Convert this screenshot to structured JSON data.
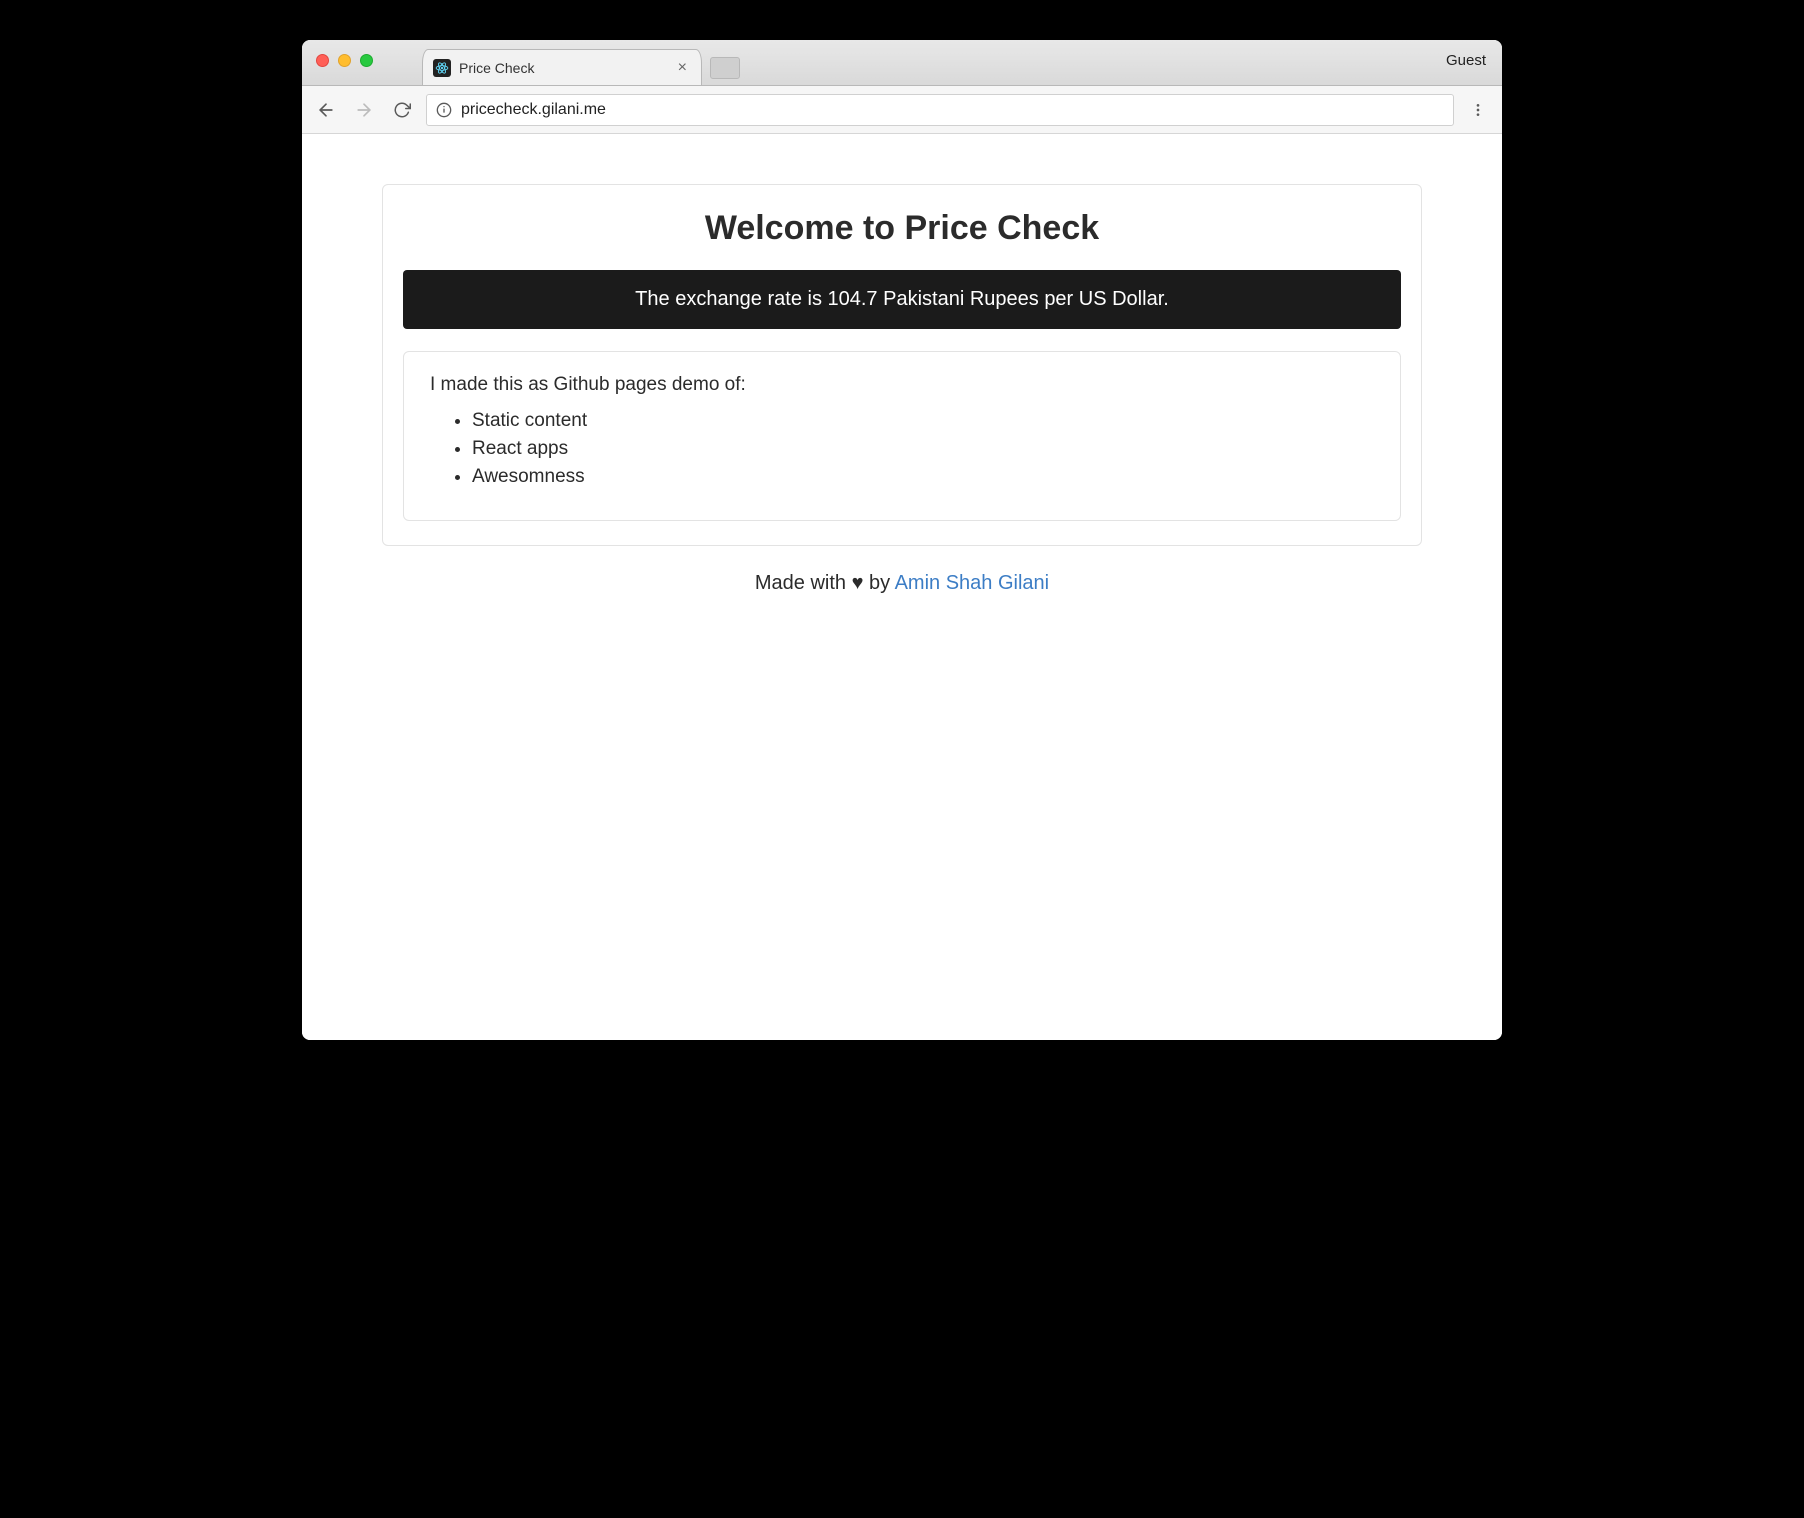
{
  "browser": {
    "tab_title": "Price Check",
    "guest_label": "Guest",
    "url": "pricecheck.gilani.me"
  },
  "page": {
    "heading": "Welcome to Price Check",
    "rate_text": "The exchange rate is 104.7 Pakistani Rupees per US Dollar.",
    "intro": "I made this as Github pages demo of:",
    "bullets": [
      "Static content",
      "React apps",
      "Awesomness"
    ],
    "footer_prefix": "Made with ",
    "footer_heart": "♥",
    "footer_by": " by ",
    "footer_author": "Amin Shah Gilani"
  }
}
